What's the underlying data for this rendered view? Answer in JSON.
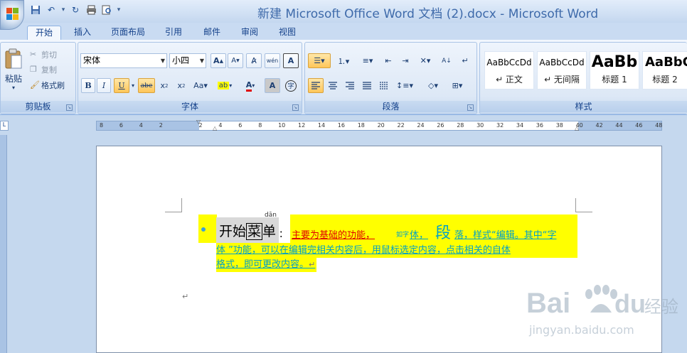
{
  "window": {
    "title": "新建 Microsoft Office Word 文档 (2).docx - Microsoft Word"
  },
  "tabs": [
    {
      "label": "开始",
      "active": true
    },
    {
      "label": "插入"
    },
    {
      "label": "页面布局"
    },
    {
      "label": "引用"
    },
    {
      "label": "邮件"
    },
    {
      "label": "审阅"
    },
    {
      "label": "视图"
    }
  ],
  "clipboard": {
    "group_label": "剪贴板",
    "paste_label": "粘贴",
    "cut_label": "剪切",
    "copy_label": "复制",
    "format_painter_label": "格式刷"
  },
  "font": {
    "group_label": "字体",
    "font_name": "宋体",
    "font_size": "小四"
  },
  "paragraph": {
    "group_label": "段落"
  },
  "styles": {
    "group_label": "样式",
    "items": [
      {
        "sample": "AaBbCcDd",
        "name": "↵ 正文"
      },
      {
        "sample": "AaBbCcDd",
        "name": "↵ 无间隔"
      },
      {
        "sample": "AaBb",
        "name": "标题 1"
      },
      {
        "sample": "AaBbC",
        "name": "标题 2"
      }
    ]
  },
  "ruler": {
    "numbers": [
      "8",
      "6",
      "4",
      "2",
      "",
      "2",
      "4",
      "6",
      "8",
      "10",
      "12",
      "14",
      "16",
      "18",
      "20",
      "22",
      "24",
      "26",
      "28",
      "30",
      "32",
      "34",
      "36",
      "38",
      "40",
      "42",
      "44",
      "46",
      "48"
    ]
  },
  "document": {
    "menu_text_a": "开始",
    "menu_text_boxed": "菜",
    "menu_text_b": "单",
    "ruby": "dān",
    "colon": "：",
    "red_text": "主要为基础的功能，",
    "small_text": "如字",
    "body_text": "体，",
    "big_text": "段",
    "rest_line1": "落，样式“编辑。其中“字",
    "line2": "体 ”功能，可以在编辑完相关内容后，用鼠标选定内容，点击相关的自体",
    "line3": "格式，即可更改内容。",
    "para_mark": "↵"
  },
  "watermark": {
    "brand": "Bai du 经验",
    "url": "jingyan.baidu.com"
  },
  "colors": {
    "highlight": "#ffff00",
    "text_cyan": "#00a0c8",
    "text_red": "#e00000",
    "ribbon_blue": "#15428b"
  }
}
